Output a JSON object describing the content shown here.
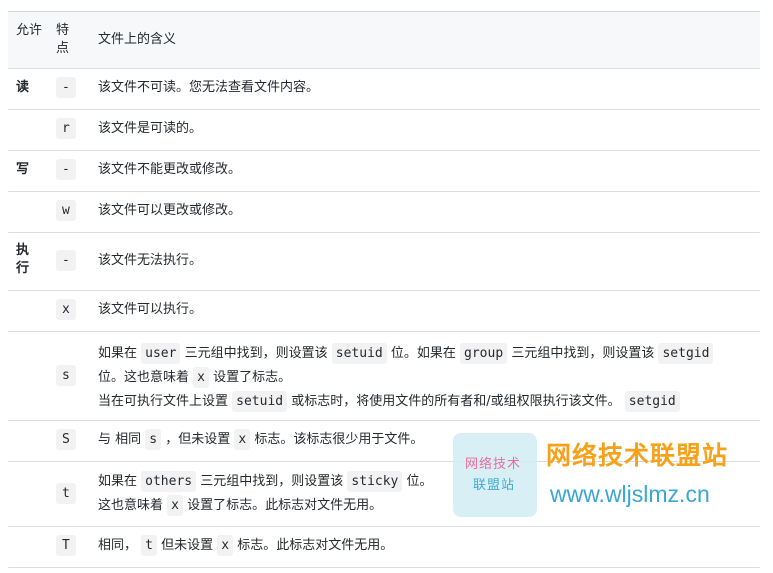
{
  "header": {
    "col1": "允许",
    "col2": "特点",
    "col3": "文件上的含义"
  },
  "rows": [
    {
      "perm": "读",
      "char": "-",
      "m1": "该文件不可读。您无法查看文件内容。"
    },
    {
      "perm": "",
      "char": "r",
      "m1": "该文件是可读的。"
    },
    {
      "perm": "写",
      "char": "-",
      "m1": "该文件不能更改或修改。"
    },
    {
      "perm": "",
      "char": "w",
      "m1": "该文件可以更改或修改。"
    },
    {
      "perm": "执行",
      "char": "-",
      "m1": "该文件无法执行。"
    },
    {
      "perm": "",
      "char": "x",
      "m1": "该文件可以执行。"
    },
    {
      "perm": "",
      "char": "s",
      "l1": [
        "如果在",
        "user",
        "三元组中找到，则设置该",
        "setuid",
        "位。如果在",
        "group",
        "三元组中找到，则设置该",
        "setgid"
      ],
      "l2": [
        "位。这也意味着",
        "x",
        "设置了标志。"
      ],
      "l3": [
        "当在可执行文件上设置",
        "setuid",
        "或标志时，将使用文件的所有者和/或组权限执行该文件。",
        "setgid"
      ]
    },
    {
      "perm": "",
      "char": "S",
      "l1": [
        "与 相同",
        "s",
        "，但未设置",
        "x",
        "标志。该标志很少用于文件。"
      ]
    },
    {
      "perm": "",
      "char": "t",
      "l1": [
        "如果在",
        "others",
        "三元组中找到，则设置该",
        "sticky",
        "位。"
      ],
      "l2": [
        "这也意味着",
        "x",
        "设置了标志。此标志对文件无用。"
      ]
    },
    {
      "perm": "",
      "char": "T",
      "l1": [
        "相同，",
        "t",
        "但未设置",
        "x",
        "标志。此标志对文件无用。"
      ]
    }
  ],
  "watermark": {
    "logo_line1": "网络技术",
    "logo_line2": "联盟站",
    "title": "网络技术联盟站",
    "url": "www.wljslmz.cn"
  }
}
